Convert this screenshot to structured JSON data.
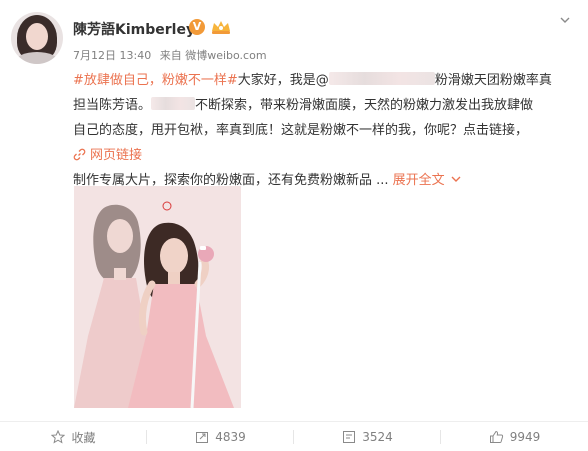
{
  "post": {
    "username": "陳芳語Kimberley",
    "verified_badge": "V",
    "date": "7月12日 13:40",
    "source": "来自 微博weibo.com",
    "text": {
      "line1_hashtag": "#放肆做自己，粉嫩不一样#",
      "line1_text": "大家好，我是@",
      "line1_end": "粉滑嫩天团粉嫩率真",
      "line2_start": "担当陈芳语。",
      "line2_end": "不断探索，带来粉滑嫩面膜，天然的粉嫩力激发出我放肆做",
      "line3": "自己的态度，甩开包袱，率真到底！这就是粉嫩不一样的我，你呢？点击链接，",
      "link_label": "网页链接",
      "line5": "制作专属大片，探索你的粉嫩面，还有免费粉嫩新品 ...",
      "expand_label": "展开全文"
    }
  },
  "actions": {
    "favorite_label": "收藏",
    "repost_count": "4839",
    "comment_count": "3524",
    "like_count": "9949"
  },
  "colors": {
    "accent": "#eb7350",
    "badge": "#f29a38"
  }
}
